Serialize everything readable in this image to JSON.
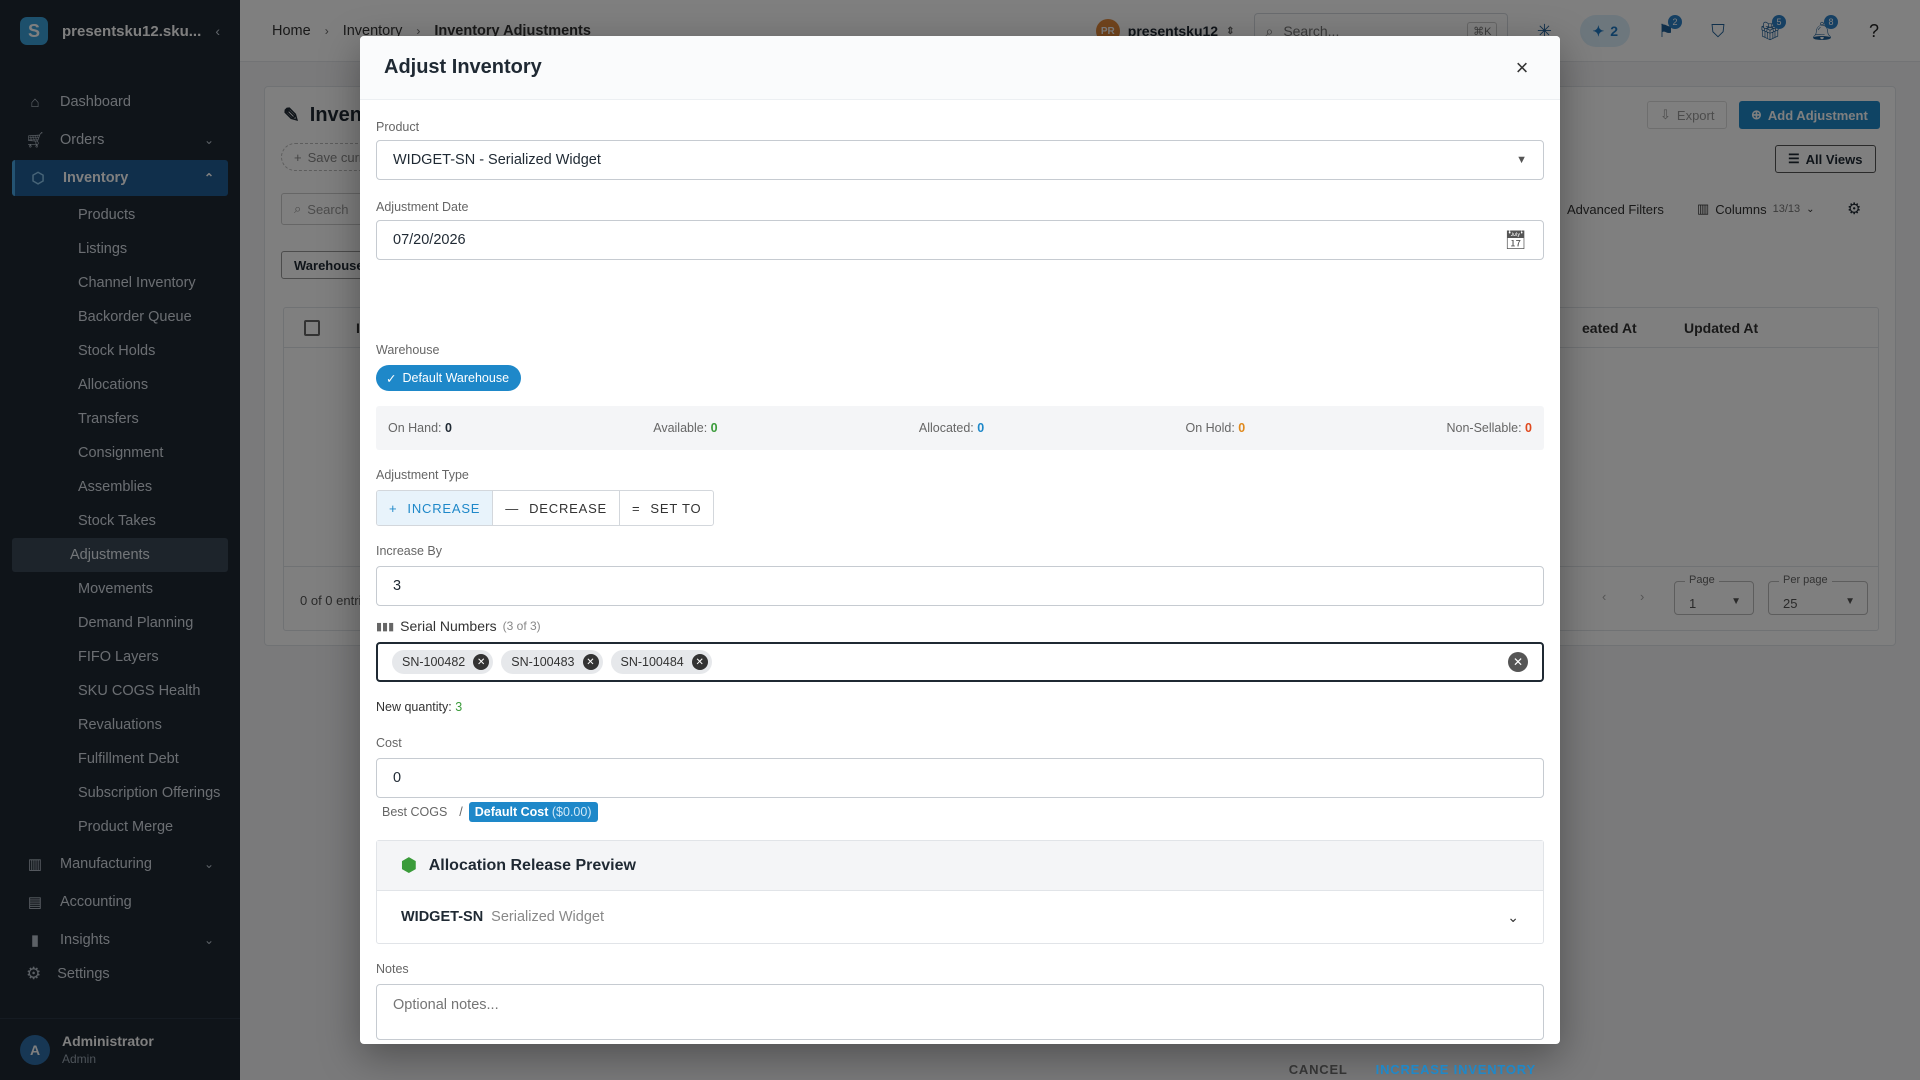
{
  "app": {
    "org_short": "presentsku12.sku..."
  },
  "sidebar": {
    "items": [
      {
        "label": "Dashboard",
        "icon": "home-icon"
      },
      {
        "label": "Orders",
        "icon": "cart-icon",
        "expandable": true
      },
      {
        "label": "Inventory",
        "icon": "box-icon",
        "expandable": true,
        "active": true
      }
    ],
    "inventory_sub": [
      "Products",
      "Listings",
      "Channel Inventory",
      "Backorder Queue",
      "Stock Holds",
      "Allocations",
      "Transfers",
      "Consignment",
      "Assemblies",
      "Stock Takes",
      "Adjustments",
      "Movements",
      "Demand Planning",
      "FIFO Layers",
      "SKU COGS Health",
      "Revaluations",
      "Fulfillment Debt",
      "Subscription Offerings",
      "Product Merge"
    ],
    "active_sub": "Adjustments",
    "bottom_items": [
      {
        "label": "Manufacturing",
        "icon": "factory-icon",
        "expandable": true
      },
      {
        "label": "Accounting",
        "icon": "book-icon"
      },
      {
        "label": "Insights",
        "icon": "bar-chart-icon",
        "expandable": true
      }
    ],
    "settings_label": "Settings",
    "user": {
      "initial": "A",
      "name": "Administrator",
      "role": "Admin"
    }
  },
  "topbar": {
    "breadcrumb": [
      "Home",
      "Inventory",
      "Inventory Adjustments"
    ],
    "org_initials": "PR",
    "org_name": "presentsku12",
    "search_placeholder": "Search...",
    "search_shortcut": "⌘K",
    "ai_count": "2",
    "badge_tasks": "2",
    "badge_gifts": "5",
    "badge_notifications": "8"
  },
  "page": {
    "title_partial": "Inven",
    "export_label": "Export",
    "add_label": "Add Adjustment",
    "save_view": "Save curre",
    "all_views": "All Views",
    "search_placeholder": "Search",
    "advanced_filters": "Advanced Filters",
    "columns_label": "Columns",
    "columns_count": "13/13",
    "warehouse_filter": "Warehouse",
    "col_partial": "I",
    "col_created": "eated At",
    "col_updated": "Updated At",
    "entries": "0 of 0 entri",
    "page_label": "Page",
    "page_value": "1",
    "per_page_label": "Per page",
    "per_page_value": "25"
  },
  "modal": {
    "title": "Adjust Inventory",
    "product_label": "Product",
    "product_value": "WIDGET-SN - Serialized Widget",
    "date_label": "Adjustment Date",
    "date_value": "07/20/2026",
    "warehouse_label": "Warehouse",
    "warehouse_chip": "Default Warehouse",
    "stock": [
      {
        "label": "On Hand:",
        "value": "0",
        "color": "#1f2933"
      },
      {
        "label": "Available:",
        "value": "0",
        "color": "#3a9b3a"
      },
      {
        "label": "Allocated:",
        "value": "0",
        "color": "#1e88c9"
      },
      {
        "label": "On Hold:",
        "value": "0",
        "color": "#e08a1e"
      },
      {
        "label": "Non-Sellable:",
        "value": "0",
        "color": "#e0491e"
      }
    ],
    "type_label": "Adjustment Type",
    "types": [
      "INCREASE",
      "DECREASE",
      "SET TO"
    ],
    "increase_label": "Increase By",
    "increase_value": "3",
    "serial_label": "Serial Numbers",
    "serial_count": "(3 of 3)",
    "serials": [
      "SN-100482",
      "SN-100483",
      "SN-100484"
    ],
    "new_qty_label": "New quantity:",
    "new_qty_value": "3",
    "cost_label": "Cost",
    "cost_value": "0",
    "cost_hint_best": "Best COGS",
    "cost_hint_sep": "/",
    "cost_hint_default": "Default Cost",
    "cost_hint_default_amount": "($0.00)",
    "preview_title": "Allocation Release Preview",
    "preview_sku": "WIDGET-SN",
    "preview_name": "Serialized Widget",
    "notes_label": "Notes",
    "notes_placeholder": "Optional notes...",
    "cancel": "CANCEL",
    "submit": "INCREASE INVENTORY"
  }
}
